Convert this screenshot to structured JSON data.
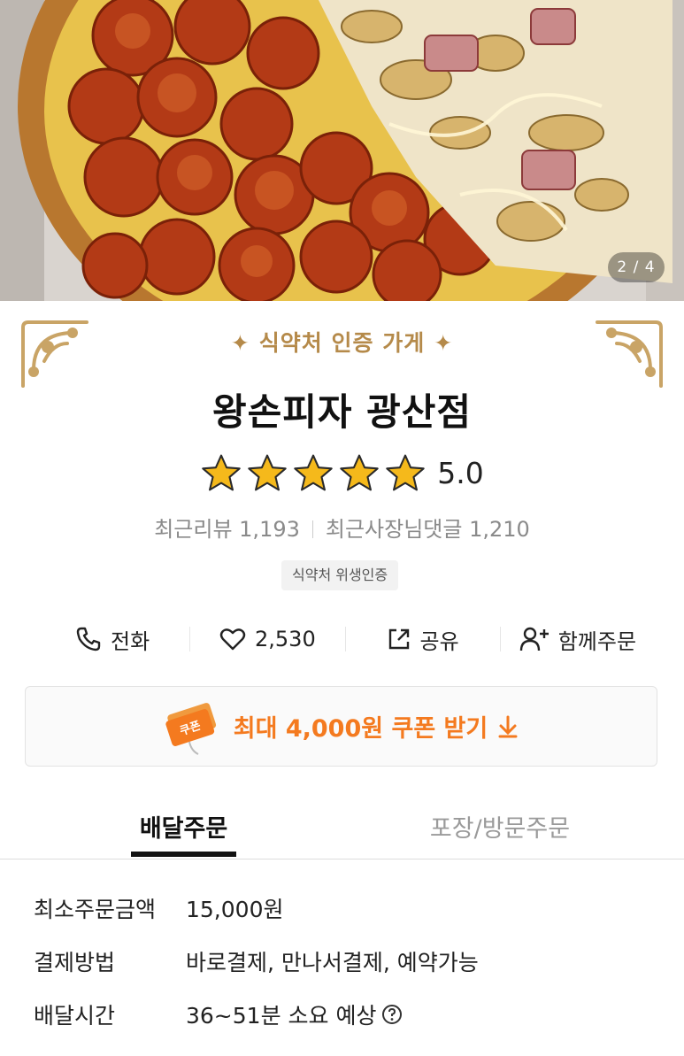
{
  "hero": {
    "page_indicator": "2 / 4"
  },
  "store": {
    "certification_banner": "식약처 인증 가게",
    "name": "왕손피자 광산점",
    "rating": "5.0",
    "stars_filled": 5,
    "recent_reviews_label": "최근리뷰 1,193",
    "recent_owner_replies_label": "최근사장님댓글 1,210",
    "hygiene_badge": "식약처 위생인증"
  },
  "actions": [
    {
      "label": "전화",
      "icon": "phone-icon"
    },
    {
      "label": "2,530",
      "icon": "heart-icon"
    },
    {
      "label": "공유",
      "icon": "share-icon"
    },
    {
      "label": "함께주문",
      "icon": "add-user-icon"
    }
  ],
  "coupon": {
    "label": "최대 4,000원 쿠폰 받기",
    "ticket_text": "쿠폰",
    "accent": "#f47a1f"
  },
  "tabs": [
    {
      "label": "배달주문",
      "active": true
    },
    {
      "label": "포장/방문주문",
      "active": false
    }
  ],
  "info": [
    {
      "label": "최소주문금액",
      "value": "15,000원"
    },
    {
      "label": "결제방법",
      "value": "바로결제, 만나서결제, 예약가능"
    },
    {
      "label": "배달시간",
      "value": "36~51분 소요 예상"
    }
  ],
  "colors": {
    "gold": "#b58a4a",
    "star": "#f5b91b",
    "text": "#222222",
    "muted": "#8a8a8a"
  }
}
